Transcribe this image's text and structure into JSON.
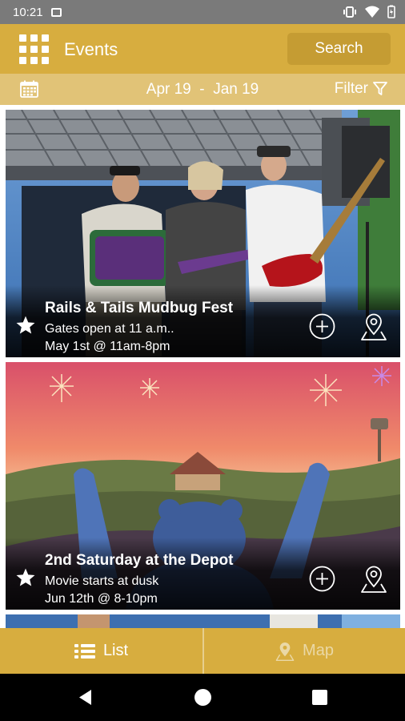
{
  "status_bar": {
    "time": "10:21"
  },
  "app_bar": {
    "title": "Events",
    "search_label": "Search",
    "menu_icon": "grid-menu-icon"
  },
  "date_bar": {
    "range": "Apr 19  -  Jan 19",
    "filter_label": "Filter",
    "calendar_icon": "calendar-icon"
  },
  "events": [
    {
      "title": "Rails & Tails Mudbug Fest",
      "subtitle": "Gates open at 11 a.m..",
      "datetime": "May 1st @ 11am-8pm"
    },
    {
      "title": "2nd Saturday at the Depot",
      "subtitle": "Movie starts at dusk",
      "datetime": "Jun 12th @ 8-10pm"
    }
  ],
  "tabs": {
    "list_label": "List",
    "map_label": "Map"
  },
  "colors": {
    "primary": "#d7ad3f",
    "secondary": "#e1c377",
    "search_button": "#c59c33"
  }
}
